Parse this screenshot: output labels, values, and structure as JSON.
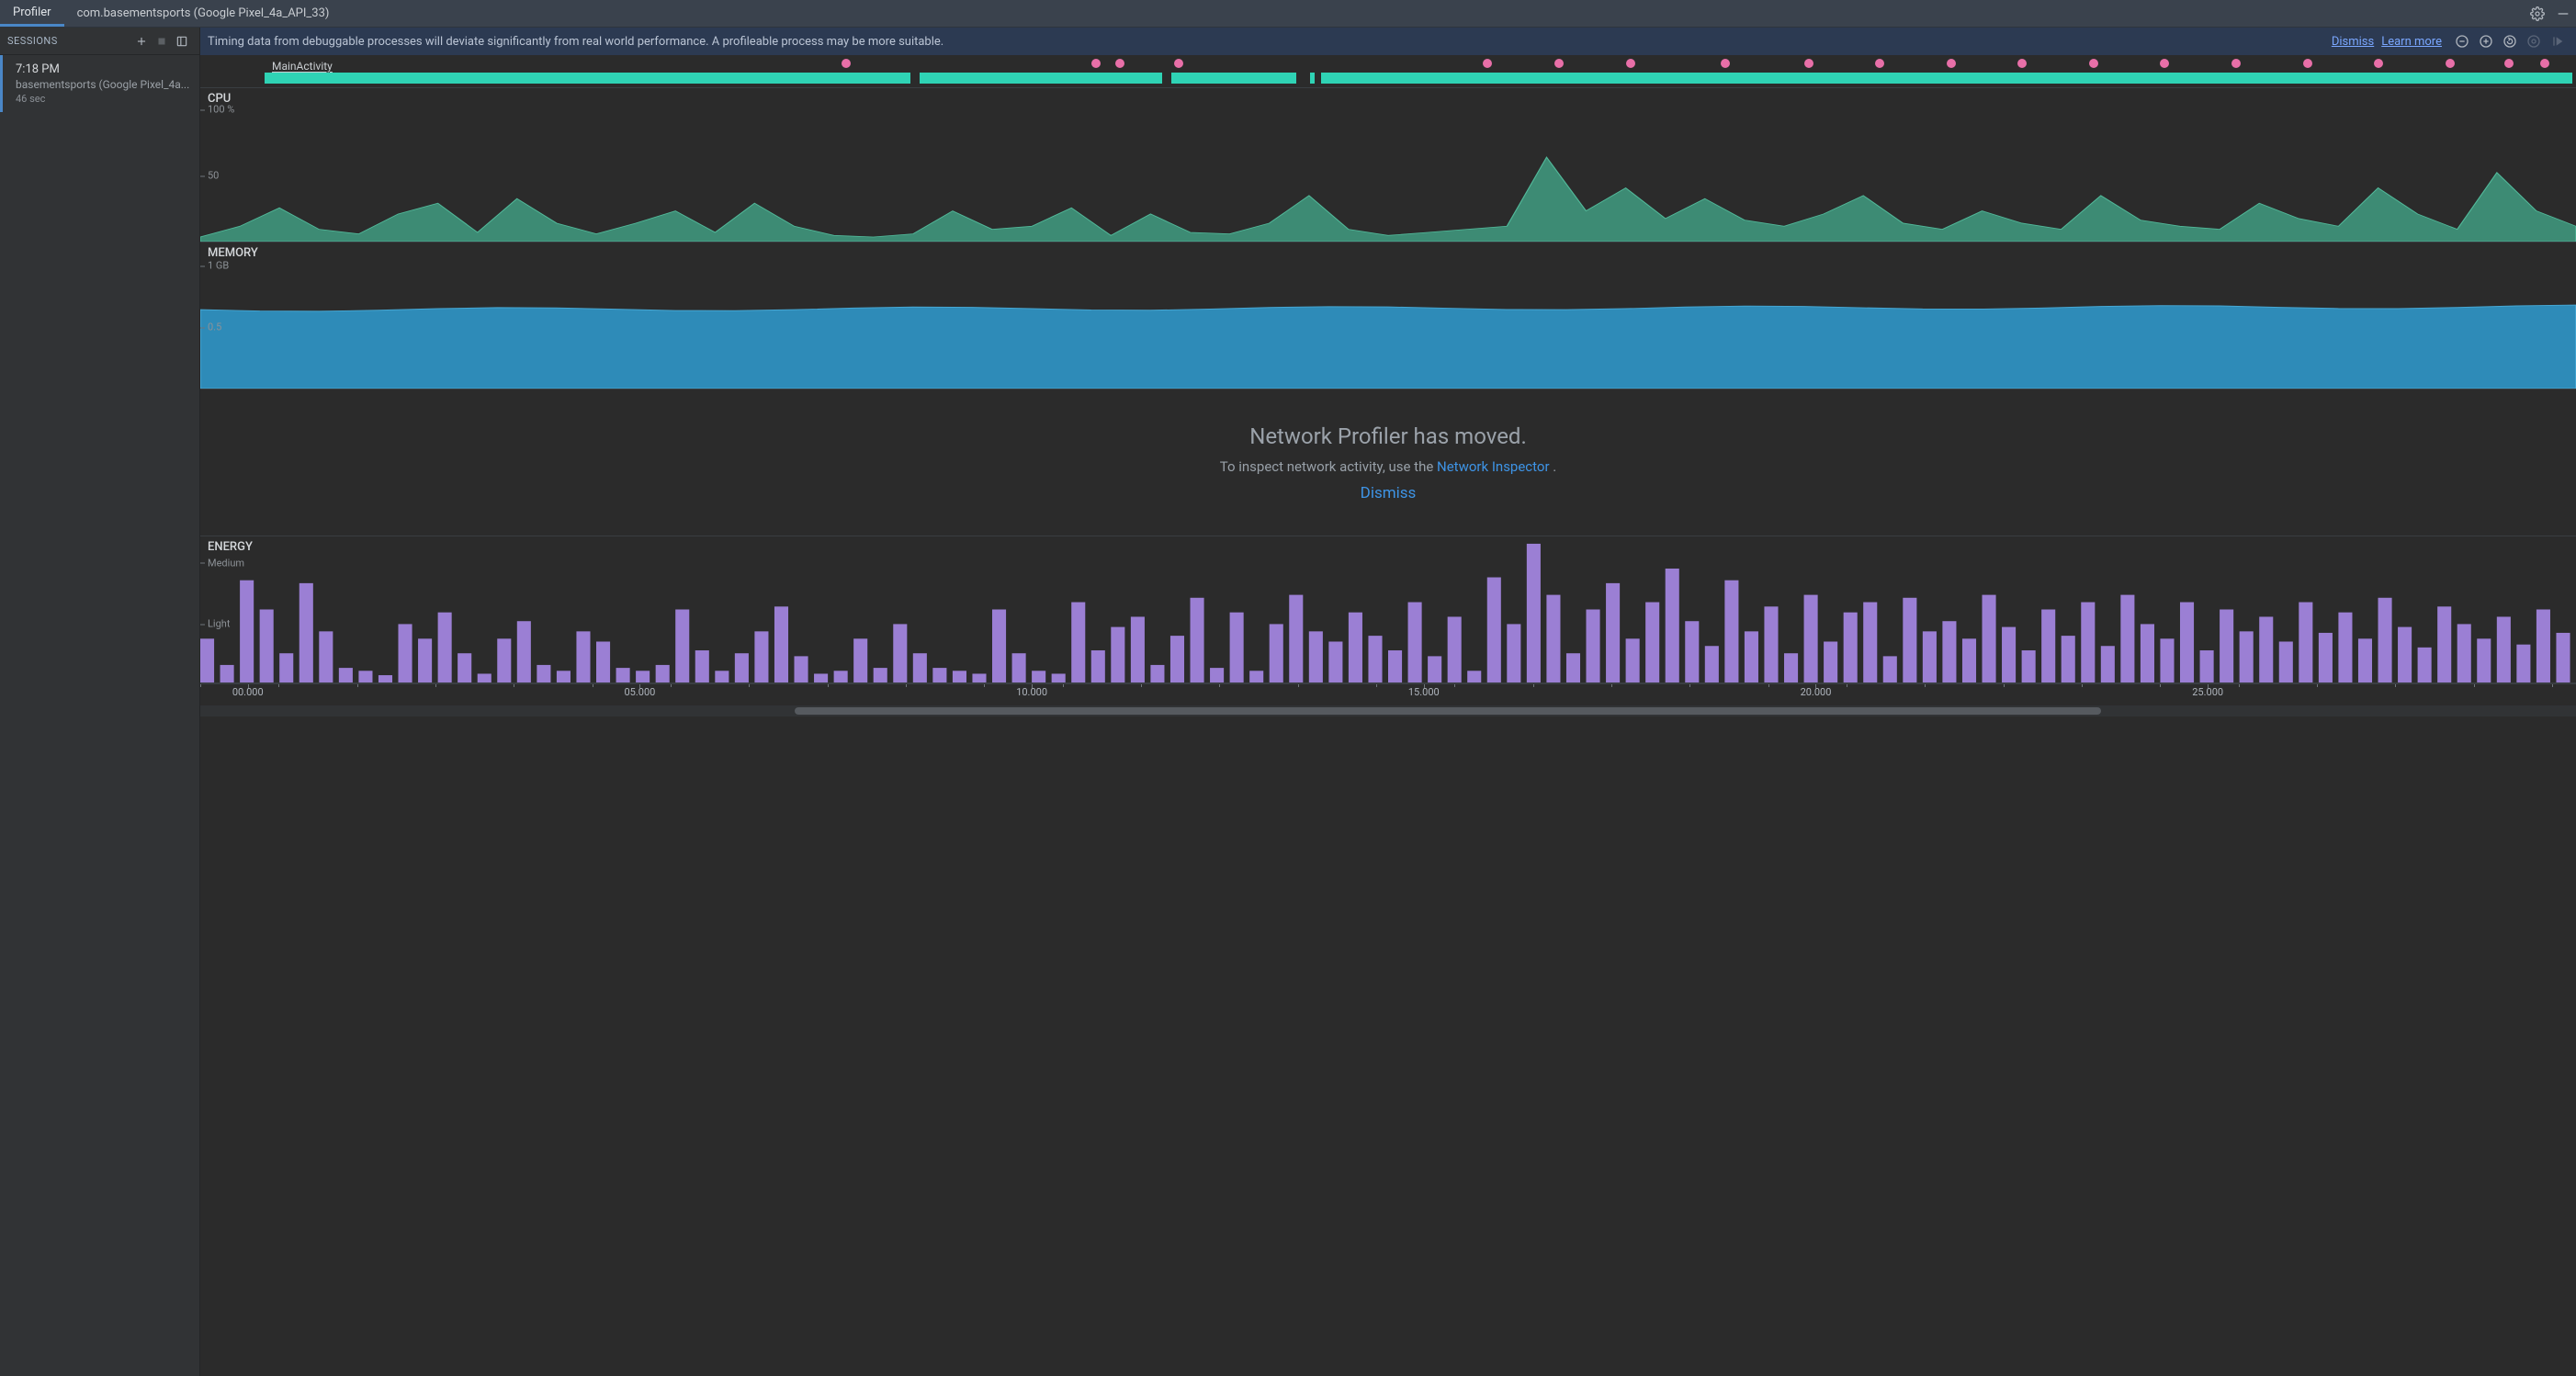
{
  "tabs": {
    "profiler": "Profiler",
    "process": "com.basementsports (Google Pixel_4a_API_33)"
  },
  "sessions": {
    "header": "SESSIONS",
    "item": {
      "time": "7:18 PM",
      "name": "basementsports (Google Pixel_4a...",
      "dur": "46 sec"
    }
  },
  "banner": {
    "msg": "Timing data from debuggable processes will deviate significantly from real world performance. A profileable process may be more suitable.",
    "dismiss": "Dismiss",
    "learn": "Learn more"
  },
  "activity": {
    "label": "MainActivity",
    "dots_pct": [
      27,
      37.5,
      38.5,
      41,
      54,
      57,
      60,
      64,
      67.5,
      70.5,
      73.5,
      76.5,
      79.5,
      82.5,
      85.5,
      88.5,
      91.5,
      94.5,
      97,
      98.5
    ],
    "gaps_pct": [
      [
        28,
        0.4
      ],
      [
        38.9,
        0.4
      ],
      [
        44.7,
        0.6
      ],
      [
        45.5,
        0.3
      ]
    ]
  },
  "cpu": {
    "title": "CPU",
    "ylabels": [
      {
        "pos_pct": 14,
        "text": "100 %"
      },
      {
        "pos_pct": 57,
        "text": "50"
      }
    ]
  },
  "memory": {
    "title": "MEMORY",
    "ylabels": [
      {
        "pos_pct": 16,
        "text": "1 GB"
      },
      {
        "pos_pct": 58,
        "text": "0.5"
      }
    ]
  },
  "network": {
    "title": "Network Profiler has moved.",
    "sub_prefix": "To inspect network activity, use the ",
    "sub_link": "Network Inspector",
    "sub_suffix": " .",
    "dismiss": "Dismiss"
  },
  "energy": {
    "title": "ENERGY",
    "ylabels": [
      {
        "pos_pct": 18,
        "text": "Medium"
      },
      {
        "pos_pct": 60,
        "text": "Light"
      }
    ]
  },
  "timeaxis": {
    "ticks": [
      {
        "pos_pct": 2,
        "text": "00.000"
      },
      {
        "pos_pct": 18.5,
        "text": "05.000"
      },
      {
        "pos_pct": 35,
        "text": "10.000"
      },
      {
        "pos_pct": 51.5,
        "text": "15.000"
      },
      {
        "pos_pct": 68,
        "text": "20.000"
      },
      {
        "pos_pct": 84.5,
        "text": "25.000"
      }
    ],
    "scroll_thumb": {
      "left_pct": 25,
      "width_pct": 55
    }
  },
  "chart_data": [
    {
      "type": "area",
      "name": "CPU",
      "title": "CPU",
      "ylabel": "%",
      "ylim": [
        0,
        100
      ],
      "x_seconds": [
        0,
        0.5,
        1,
        1.5,
        2,
        2.5,
        3,
        3.5,
        4,
        4.5,
        5,
        5.5,
        6,
        6.5,
        7,
        7.5,
        8,
        8.5,
        9,
        9.5,
        10,
        10.5,
        11,
        11.5,
        12,
        12.5,
        13,
        13.5,
        14,
        14.5,
        15,
        15.5,
        16,
        16.5,
        17,
        17.5,
        18,
        18.5,
        19,
        19.5,
        20,
        20.5,
        21,
        21.5,
        22,
        22.5,
        23,
        23.5,
        24,
        24.5,
        25,
        25.5,
        26,
        26.5,
        27,
        27.5,
        28,
        28.5,
        29,
        29.5,
        30
      ],
      "values": [
        3,
        10,
        22,
        8,
        5,
        18,
        25,
        6,
        28,
        12,
        5,
        12,
        20,
        6,
        25,
        10,
        4,
        3,
        5,
        20,
        8,
        10,
        22,
        4,
        18,
        6,
        5,
        12,
        30,
        8,
        4,
        6,
        8,
        10,
        55,
        20,
        35,
        15,
        28,
        14,
        10,
        18,
        30,
        12,
        8,
        20,
        12,
        8,
        30,
        14,
        10,
        8,
        25,
        15,
        10,
        35,
        18,
        8,
        45,
        20,
        10
      ]
    },
    {
      "type": "area",
      "name": "Memory",
      "title": "MEMORY",
      "ylabel": "GB",
      "ylim": [
        0,
        1
      ],
      "x_seconds": [
        0,
        30
      ],
      "values": [
        0.54,
        0.56
      ],
      "note": "near-flat allocation around ~0.55 GB for whole window"
    },
    {
      "type": "bar",
      "name": "Energy",
      "title": "ENERGY",
      "ylabel": "",
      "ylim": [
        0,
        100
      ],
      "y_tick_labels": [
        "Light",
        "Medium"
      ],
      "x_seconds_step": 0.25,
      "values": [
        30,
        12,
        70,
        50,
        20,
        68,
        35,
        10,
        8,
        5,
        40,
        30,
        48,
        20,
        6,
        30,
        42,
        12,
        8,
        35,
        28,
        10,
        8,
        12,
        50,
        22,
        8,
        20,
        35,
        52,
        18,
        6,
        8,
        30,
        10,
        40,
        20,
        10,
        8,
        6,
        50,
        20,
        8,
        6,
        55,
        22,
        38,
        45,
        12,
        32,
        58,
        10,
        48,
        8,
        40,
        60,
        35,
        28,
        48,
        32,
        22,
        55,
        18,
        45,
        8,
        72,
        40,
        95,
        60,
        20,
        50,
        68,
        30,
        55,
        78,
        42,
        25,
        70,
        35,
        52,
        20,
        60,
        28,
        48,
        55,
        18,
        58,
        35,
        42,
        30,
        60,
        38,
        22,
        50,
        32,
        55,
        25,
        60,
        40,
        30,
        55,
        22,
        50,
        35,
        45,
        28,
        55,
        34,
        48,
        30,
        58,
        38,
        24,
        52,
        40,
        30,
        45,
        26,
        50,
        34
      ]
    }
  ]
}
